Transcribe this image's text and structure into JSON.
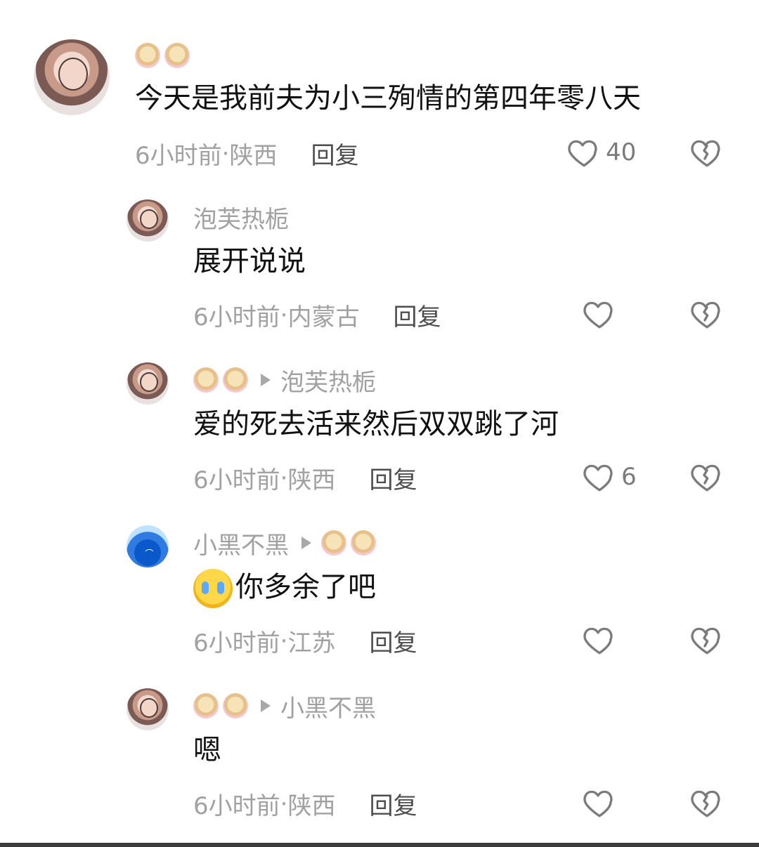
{
  "comments": [
    {
      "username": "",
      "reply_to": "",
      "text": "今天是我前夫为小三殉情的第四年零八天",
      "time": "6小时前",
      "location": "陕西",
      "reply_label": "回复",
      "likes": "40"
    },
    {
      "username": "泡芙热栀",
      "reply_to": "",
      "text": "展开说说",
      "time": "6小时前",
      "location": "内蒙古",
      "reply_label": "回复",
      "likes": ""
    },
    {
      "username": "",
      "reply_to": "泡芙热栀",
      "text": "爱的死去活来然后双双跳了河",
      "time": "6小时前",
      "location": "陕西",
      "reply_label": "回复",
      "likes": "6"
    },
    {
      "username": "小黑不黑",
      "reply_to": "",
      "text": "你多余了吧",
      "time": "6小时前",
      "location": "江苏",
      "reply_label": "回复",
      "likes": ""
    },
    {
      "username": "",
      "reply_to": "小黑不黑",
      "text": "嗯",
      "time": "6小时前",
      "location": "陕西",
      "reply_label": "回复",
      "likes": ""
    }
  ],
  "separator": "·",
  "icons": {
    "like": "heart-outline-icon",
    "dislike": "broken-heart-outline-icon",
    "reply_arrow": "triangle-right-icon",
    "emoji_username": "woman-tipping-hand-emoji",
    "emoji_crying": "loudly-crying-face-emoji"
  },
  "colors": {
    "text_primary": "#111111",
    "text_secondary": "#a1a1a1",
    "reply_text": "#4d4d4d",
    "icon_gray": "#7b7b7b"
  }
}
